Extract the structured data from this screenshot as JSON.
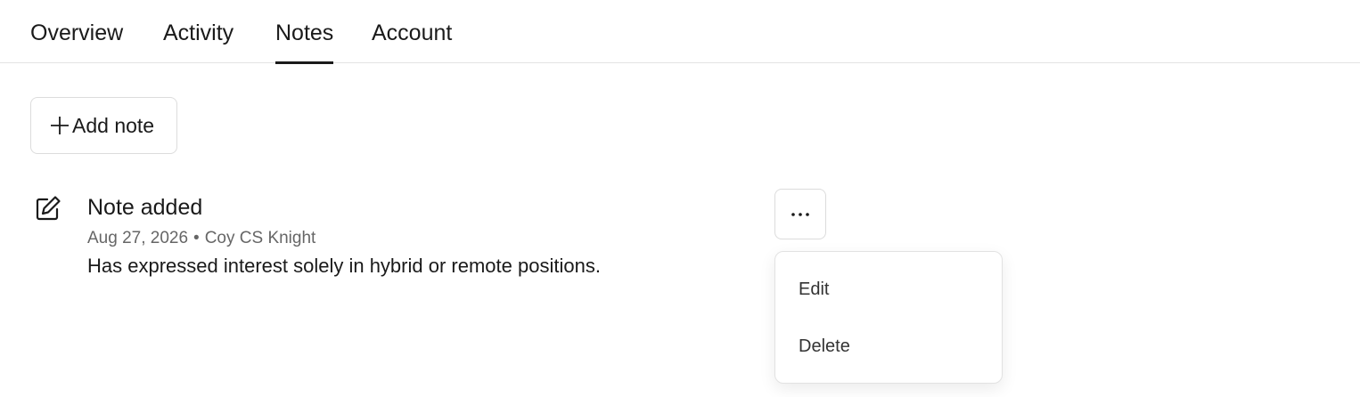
{
  "tabs": [
    {
      "label": "Overview",
      "active": false
    },
    {
      "label": "Activity",
      "active": false
    },
    {
      "label": "Notes",
      "active": true
    },
    {
      "label": "Account",
      "active": false
    }
  ],
  "toolbar": {
    "add_note_label": "Add note",
    "add_note_icon": "plus-icon"
  },
  "note": {
    "icon": "edit-note-icon",
    "title": "Note added",
    "date": "Aug 27, 2026",
    "separator": "•",
    "author": "Coy CS Knight",
    "body": "Has expressed interest solely in hybrid or remote positions.",
    "more_icon": "ellipsis-icon"
  },
  "menu": {
    "items": [
      {
        "label": "Edit"
      },
      {
        "label": "Delete"
      }
    ]
  },
  "colors": {
    "text": "#1a1a1a",
    "muted": "#666666",
    "border": "#dcdcdc",
    "active_underline": "#1a1a1a"
  }
}
